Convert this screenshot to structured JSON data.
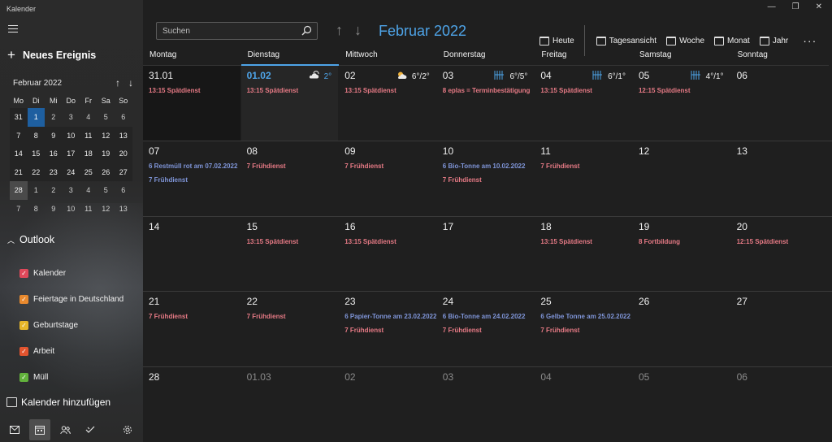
{
  "app": {
    "title": "Kalender"
  },
  "sidebar": {
    "new_event": "Neues Ereignis",
    "mini_calendar": {
      "month": "Februar 2022",
      "weekdays": [
        "Mo",
        "Di",
        "Mi",
        "Do",
        "Fr",
        "Sa",
        "So"
      ],
      "rows": [
        [
          "31",
          "1",
          "2",
          "3",
          "4",
          "5",
          "6"
        ],
        [
          "7",
          "8",
          "9",
          "10",
          "11",
          "12",
          "13"
        ],
        [
          "14",
          "15",
          "16",
          "17",
          "18",
          "19",
          "20"
        ],
        [
          "21",
          "22",
          "23",
          "24",
          "25",
          "26",
          "27"
        ],
        [
          "28",
          "1",
          "2",
          "3",
          "4",
          "5",
          "6"
        ],
        [
          "7",
          "8",
          "9",
          "10",
          "11",
          "12",
          "13"
        ]
      ]
    },
    "account": "Outlook",
    "calendars": [
      {
        "label": "Kalender",
        "color": "#e0485a"
      },
      {
        "label": "Feiertage in Deutschland",
        "color": "#e8892e"
      },
      {
        "label": "Geburtstage",
        "color": "#e6b72a"
      },
      {
        "label": "Arbeit",
        "color": "#e2542f"
      },
      {
        "label": "Müll",
        "color": "#62b23c"
      }
    ],
    "add_calendar": "Kalender hinzufügen"
  },
  "header": {
    "search_placeholder": "Suchen",
    "month_title": "Februar 2022",
    "toolbar": {
      "today": "Heute",
      "day_view": "Tagesansicht",
      "week": "Woche",
      "month": "Monat",
      "year": "Jahr"
    }
  },
  "weekdays": [
    "Montag",
    "Dienstag",
    "Mittwoch",
    "Donnerstag",
    "Freitag",
    "Samstag",
    "Sonntag"
  ],
  "weeks": [
    [
      {
        "num": "31.01",
        "state": "past",
        "events": [
          {
            "text": "13:15 Spätdienst",
            "color": "red"
          }
        ]
      },
      {
        "num": "01.02",
        "state": "today",
        "weather": {
          "icon": "cloudy-icon",
          "temp": "2°"
        },
        "events": [
          {
            "text": "13:15 Spätdienst",
            "color": "red"
          }
        ]
      },
      {
        "num": "02",
        "weather": {
          "icon": "partly-sunny-icon",
          "temp": "6°/2°"
        },
        "events": [
          {
            "text": "13:15 Spätdienst",
            "color": "red"
          }
        ]
      },
      {
        "num": "03",
        "weather": {
          "icon": "rain-icon",
          "temp": "6°/5°"
        },
        "events": [
          {
            "text": "8 eplas = Terminbestätigung",
            "color": "red"
          }
        ]
      },
      {
        "num": "04",
        "weather": {
          "icon": "rain-icon",
          "temp": "6°/1°"
        },
        "events": [
          {
            "text": "13:15 Spätdienst",
            "color": "red"
          }
        ]
      },
      {
        "num": "05",
        "weather": {
          "icon": "rain-icon",
          "temp": "4°/1°"
        },
        "events": [
          {
            "text": "12:15 Spätdienst",
            "color": "red"
          }
        ]
      },
      {
        "num": "06",
        "events": []
      }
    ],
    [
      {
        "num": "07",
        "events": [
          {
            "text": "6 Restmüll rot am 07.02.2022",
            "color": "blue"
          },
          {
            "text": "7 Frühdienst",
            "color": "blue"
          }
        ]
      },
      {
        "num": "08",
        "events": [
          {
            "text": "7 Frühdienst",
            "color": "red"
          }
        ]
      },
      {
        "num": "09",
        "events": [
          {
            "text": "7 Frühdienst",
            "color": "red"
          }
        ]
      },
      {
        "num": "10",
        "events": [
          {
            "text": "6 Bio-Tonne am 10.02.2022",
            "color": "blue"
          },
          {
            "text": "7 Frühdienst",
            "color": "red"
          }
        ]
      },
      {
        "num": "11",
        "events": [
          {
            "text": "7 Frühdienst",
            "color": "red"
          }
        ]
      },
      {
        "num": "12",
        "events": []
      },
      {
        "num": "13",
        "events": []
      }
    ],
    [
      {
        "num": "14",
        "events": []
      },
      {
        "num": "15",
        "events": [
          {
            "text": "13:15 Spätdienst",
            "color": "red"
          }
        ]
      },
      {
        "num": "16",
        "events": [
          {
            "text": "13:15 Spätdienst",
            "color": "red"
          }
        ]
      },
      {
        "num": "17",
        "events": []
      },
      {
        "num": "18",
        "events": [
          {
            "text": "13:15 Spätdienst",
            "color": "red"
          }
        ]
      },
      {
        "num": "19",
        "events": [
          {
            "text": "8 Fortbildung",
            "color": "red"
          }
        ]
      },
      {
        "num": "20",
        "events": [
          {
            "text": "12:15 Spätdienst",
            "color": "red"
          }
        ]
      }
    ],
    [
      {
        "num": "21",
        "events": [
          {
            "text": "7 Frühdienst",
            "color": "red"
          }
        ]
      },
      {
        "num": "22",
        "events": [
          {
            "text": "7 Frühdienst",
            "color": "red"
          }
        ]
      },
      {
        "num": "23",
        "events": [
          {
            "text": "6 Papier-Tonne am 23.02.2022",
            "color": "blue"
          },
          {
            "text": "7 Frühdienst",
            "color": "red"
          }
        ]
      },
      {
        "num": "24",
        "events": [
          {
            "text": "6 Bio-Tonne am 24.02.2022",
            "color": "blue"
          },
          {
            "text": "7 Frühdienst",
            "color": "red"
          }
        ]
      },
      {
        "num": "25",
        "events": [
          {
            "text": "6 Gelbe Tonne am 25.02.2022",
            "color": "blue"
          },
          {
            "text": "7 Frühdienst",
            "color": "red"
          }
        ]
      },
      {
        "num": "26",
        "events": []
      },
      {
        "num": "27",
        "events": []
      }
    ],
    [
      {
        "num": "28",
        "events": []
      },
      {
        "num": "01.03",
        "state": "other",
        "events": []
      },
      {
        "num": "02",
        "state": "other",
        "events": []
      },
      {
        "num": "03",
        "state": "other",
        "events": []
      },
      {
        "num": "04",
        "state": "other",
        "events": []
      },
      {
        "num": "05",
        "state": "other",
        "events": []
      },
      {
        "num": "06",
        "state": "other",
        "events": []
      }
    ]
  ]
}
